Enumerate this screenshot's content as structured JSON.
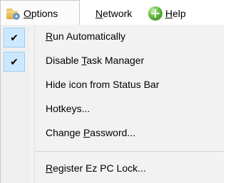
{
  "menubar": {
    "options": {
      "pre": "",
      "accel": "O",
      "post": "ptions"
    },
    "network": {
      "pre": "",
      "accel": "N",
      "post": "etwork"
    },
    "help": {
      "pre": "",
      "accel": "H",
      "post": "elp"
    }
  },
  "menu": {
    "items": [
      {
        "pre": "",
        "accel": "R",
        "post": "un Automatically",
        "checked": true
      },
      {
        "pre": "Disable ",
        "accel": "T",
        "post": "ask Manager",
        "checked": true
      },
      {
        "pre": "Hide icon from Status Bar",
        "accel": "",
        "post": "",
        "checked": false
      },
      {
        "pre": "Hotkeys...",
        "accel": "",
        "post": "",
        "checked": false
      },
      {
        "pre": "Change ",
        "accel": "P",
        "post": "assword...",
        "checked": false
      },
      {
        "pre": "",
        "accel": "R",
        "post": "egister Ez PC Lock...",
        "checked": false
      }
    ],
    "check_glyph": "✔"
  },
  "icons": {
    "options_icon": "folder-gear-icon",
    "help_icon": "help-globe-icon"
  }
}
